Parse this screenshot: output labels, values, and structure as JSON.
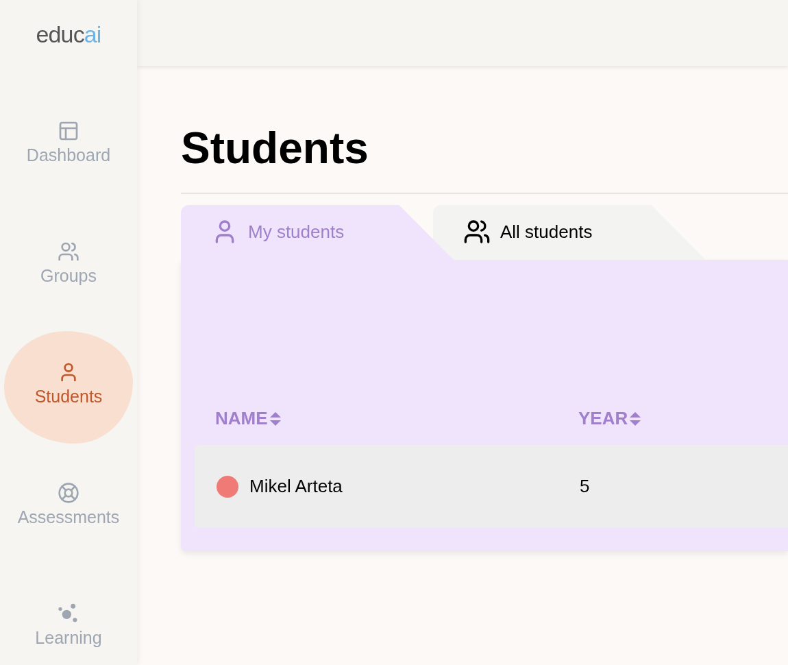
{
  "logo": {
    "primary": "educ",
    "accent": "ai"
  },
  "sidebar": {
    "items": [
      {
        "kind": "dashboard",
        "label": "Dashboard",
        "selected": false
      },
      {
        "kind": "groups",
        "label": "Groups",
        "selected": false
      },
      {
        "kind": "student",
        "label": "Students",
        "selected": true
      },
      {
        "kind": "assessments",
        "label": "Assessments",
        "selected": false
      },
      {
        "kind": "learning",
        "label": "Learning",
        "selected": false
      }
    ]
  },
  "page": {
    "title": "Students"
  },
  "tabs": [
    {
      "kind": "single",
      "label": "My students",
      "selected": true
    },
    {
      "kind": "multi",
      "label": "All students",
      "selected": false
    }
  ],
  "table": {
    "columns": [
      "NAME",
      "YEAR"
    ],
    "rows": [
      {
        "name": "Mikel Arteta",
        "year": "5",
        "color": "#f07b76"
      }
    ]
  }
}
